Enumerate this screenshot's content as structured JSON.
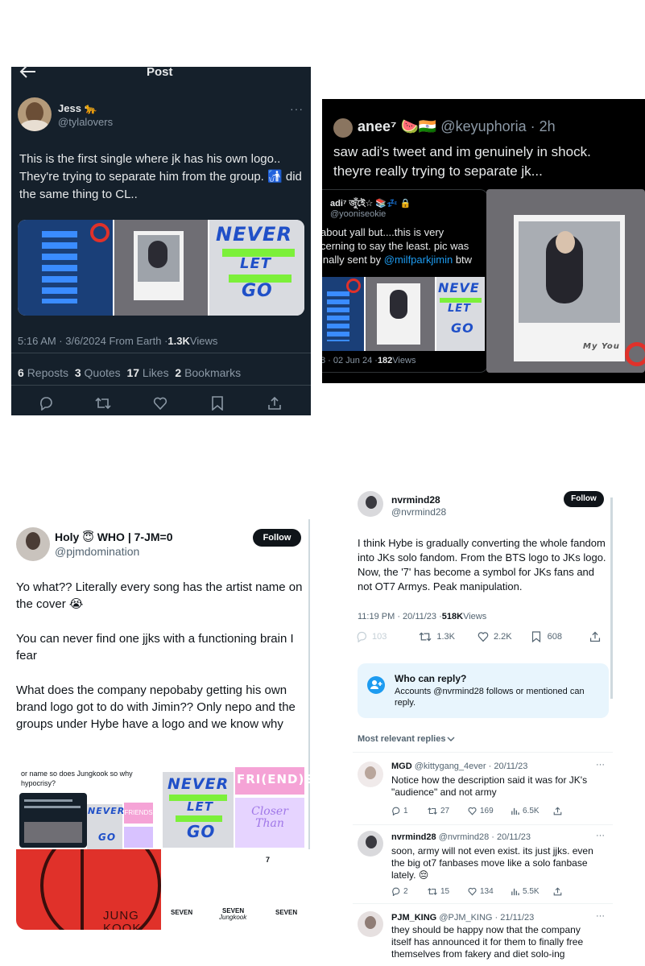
{
  "panel1": {
    "header_title": "Post",
    "author_name": "Jess 🐆",
    "author_handle": "@tylalovers",
    "tweet_text": "This is the first single where jk has his own logo.. They're trying to separate him from the group. 🚮 did the same thing to CL..",
    "media_never": "NEVER",
    "media_let": "LET",
    "media_go": "GO",
    "time": "5:16 AM · 3/6/2024 From Earth · ",
    "views_count": "1.3K",
    "views_label": " Views",
    "reposts_count": "6",
    "reposts_label": "Reposts",
    "quotes_count": "3",
    "quotes_label": "Quotes",
    "likes_count": "17",
    "likes_label": "Likes",
    "bookmarks_count": "2",
    "bookmarks_label": "Bookmarks"
  },
  "panel2": {
    "author_name": "anee⁷ 🍉🇮🇳",
    "author_handle": "@keyuphoria · 2h",
    "tweet_text": "saw adi's tweet and im genuinely in shock. theyre really trying to separate jk...",
    "quoted_name": "adi⁷ জুঁইে☆ 📚💤 🔒",
    "quoted_handle": "@yooniseokie",
    "quoted_text_1": "about yall but....this is very",
    "quoted_text_2": "cerning to say the least. pic was",
    "quoted_text_3": "inally sent by ",
    "quoted_mention": "@milfparkjimin",
    "quoted_text_4": " btw",
    "quoted_time": "8 · 02 Jun 24 · ",
    "quoted_views_count": "182",
    "quoted_views_label": " Views",
    "media_never": "NEVE",
    "media_let": "LET",
    "media_go": "GO",
    "polaroid_caption": "My You"
  },
  "panel3": {
    "author_name": "Holy 😇 WHO | 7-JM=0",
    "author_handle": "@pjmdomination",
    "follow_label": "Follow",
    "para1": "Yo what?? Literally every song has the artist name on the cover 😭",
    "para2": "You can never find one jjks with a functioning brain I fear",
    "para3": "What does the company nepobaby getting his own brand logo got to do with Jimin?? Only nepo and the groups under Hybe have a logo and we know why",
    "collage_caption": "or name so does Jungkook so why hypocrisy?",
    "collage_never": "NEVER",
    "collage_let": "LET",
    "collage_go": "GO",
    "collage_friends": "FRI(END)S",
    "collage_friends_small": "FRIENDS",
    "collage_closer": "Closer Than",
    "collage_jung": "JUNG",
    "collage_kook": "KOOK",
    "collage_seven_1": "SEVEN",
    "collage_seven_2": "SEVEN",
    "collage_seven_3": "SEVEN",
    "collage_jk_sign": "Jungkook",
    "collage_seven_num": "7"
  },
  "panel4": {
    "author_name": "nvrmind28",
    "author_handle": "@nvrmind28",
    "follow_label": "Follow",
    "tweet_text": "I think Hybe is gradually converting the whole fandom into JKs solo fandom. From the BTS logo to JKs logo. Now, the '7' has become a symbol for JKs fans and not OT7 Armys. Peak manipulation.",
    "time": "11:19 PM · 20/11/23 · ",
    "views_count": "518K",
    "views_label": " Views",
    "stat_replies": "103",
    "stat_reposts": "1.3K",
    "stat_likes": "2.2K",
    "stat_bookmarks": "608",
    "reply_title": "Who can reply?",
    "reply_desc": "Accounts @nvrmind28 follows or mentioned can reply.",
    "sort_label": "Most relevant replies",
    "replies": [
      {
        "name": "MGD",
        "meta": "@kittygang_4ever · 20/11/23",
        "text": "Notice how the description said it was for JK's \"audience\" and not army",
        "replies": "1",
        "reposts": "27",
        "likes": "169",
        "views": "6.5K"
      },
      {
        "name": "nvrmind28",
        "meta": "@nvrmind28 · 20/11/23",
        "text": "soon, army will not even exist. its just jjks. even the big ot7 fanbases move like a solo fanbase lately. 😔",
        "replies": "2",
        "reposts": "15",
        "likes": "134",
        "views": "5.5K"
      },
      {
        "name": "PJM_KING",
        "meta": "@PJM_KING · 21/11/23",
        "text": "they should be happy now that the company itself has announced it for them to finally free themselves from fakery and diet solo-ing",
        "replies": "",
        "reposts": "",
        "likes": "",
        "views": ""
      }
    ]
  },
  "colors": {
    "dark_bg": "#15202b",
    "accent_blue": "#1d9bf0",
    "neon_green": "#7cf03a",
    "red_accent": "#e0312a",
    "pink": "#f5a3d6",
    "lavender": "#c9a8ff"
  },
  "icons": [
    "back-arrow-icon",
    "more-icon",
    "reply-icon",
    "repost-icon",
    "like-icon",
    "bookmark-icon",
    "share-icon",
    "views-icon",
    "lock-icon",
    "chevron-down-icon",
    "person-plus-icon"
  ]
}
